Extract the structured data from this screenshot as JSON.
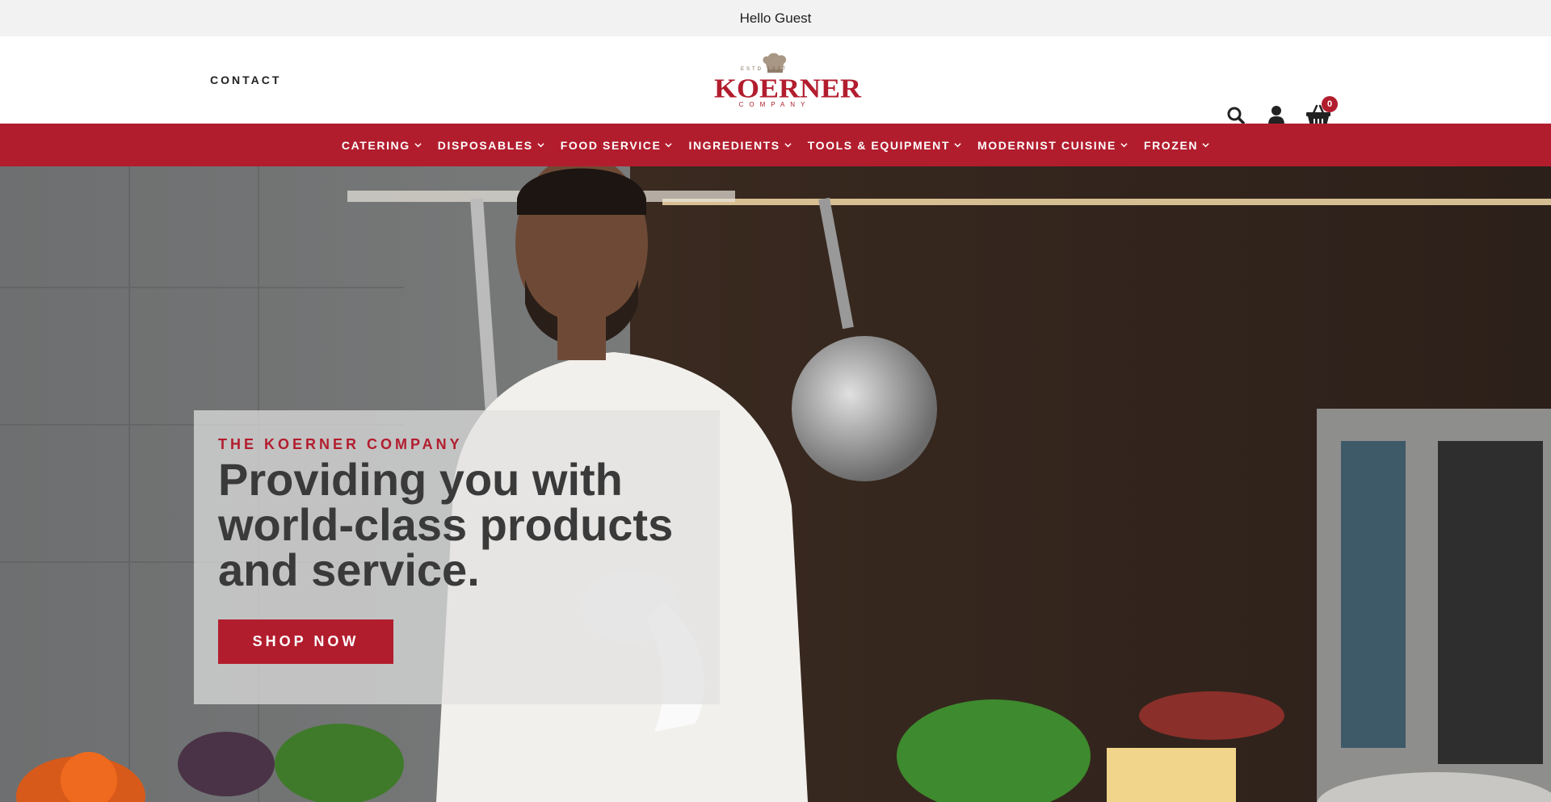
{
  "announcement": {
    "text": "Hello Guest"
  },
  "header": {
    "contact_label": "CONTACT",
    "logo": {
      "est": "ESTD 1937",
      "word": "KOERNER",
      "company": "COMPANY"
    },
    "cart_count": "0"
  },
  "nav": {
    "items": [
      {
        "label": "CATERING"
      },
      {
        "label": "DISPOSABLES"
      },
      {
        "label": "FOOD SERVICE"
      },
      {
        "label": "INGREDIENTS"
      },
      {
        "label": "TOOLS & EQUIPMENT"
      },
      {
        "label": "MODERNIST CUISINE"
      },
      {
        "label": "FROZEN"
      }
    ]
  },
  "hero": {
    "eyebrow": "THE KOERNER COMPANY",
    "headline": "Providing you with world-class products and service.",
    "cta_label": "SHOP NOW"
  },
  "colors": {
    "brand": "#b21d2e",
    "announcement_bg": "#f2f2f2",
    "text": "#222222"
  },
  "icons": {
    "search": "search-icon",
    "account": "user-icon",
    "cart": "basket-icon",
    "nav_dropdown": "chevron-down-icon"
  }
}
